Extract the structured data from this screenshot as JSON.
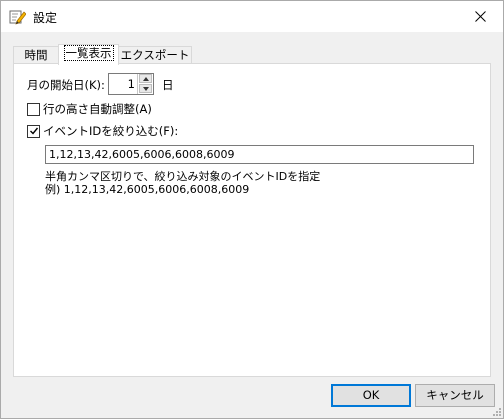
{
  "window": {
    "title": "設定"
  },
  "tabs": [
    {
      "label": "時間",
      "active": false
    },
    {
      "label": "一覧表示",
      "active": true
    },
    {
      "label": "エクスポート",
      "active": false
    }
  ],
  "panel": {
    "start_day": {
      "label": "月の開始日(K):",
      "value": "1",
      "unit": "日"
    },
    "auto_row_height": {
      "label": "行の高さ自動調整(A)",
      "checked": false
    },
    "filter_event_ids": {
      "label": "イベントIDを絞り込む(F):",
      "checked": true
    },
    "event_ids_value": "1,12,13,42,6005,6006,6008,6009",
    "hint_line1": "半角カンマ区切りで、絞り込み対象のイベントIDを指定",
    "hint_line2": "例) 1,12,13,42,6005,6006,6008,6009"
  },
  "buttons": {
    "ok": "OK",
    "cancel": "キャンセル"
  },
  "icons": {
    "app": "settings-pencil-icon",
    "close": "close-icon"
  }
}
